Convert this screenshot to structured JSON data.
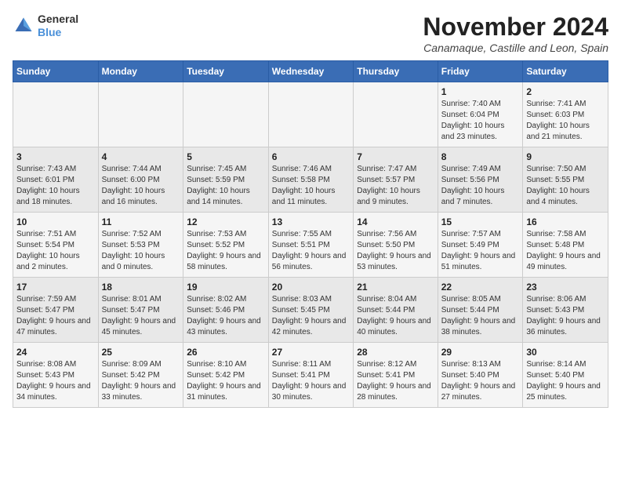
{
  "logo": {
    "general": "General",
    "blue": "Blue"
  },
  "header": {
    "month": "November 2024",
    "location": "Canamaque, Castille and Leon, Spain"
  },
  "weekdays": [
    "Sunday",
    "Monday",
    "Tuesday",
    "Wednesday",
    "Thursday",
    "Friday",
    "Saturday"
  ],
  "weeks": [
    [
      {
        "day": "",
        "info": ""
      },
      {
        "day": "",
        "info": ""
      },
      {
        "day": "",
        "info": ""
      },
      {
        "day": "",
        "info": ""
      },
      {
        "day": "",
        "info": ""
      },
      {
        "day": "1",
        "info": "Sunrise: 7:40 AM\nSunset: 6:04 PM\nDaylight: 10 hours and 23 minutes."
      },
      {
        "day": "2",
        "info": "Sunrise: 7:41 AM\nSunset: 6:03 PM\nDaylight: 10 hours and 21 minutes."
      }
    ],
    [
      {
        "day": "3",
        "info": "Sunrise: 7:43 AM\nSunset: 6:01 PM\nDaylight: 10 hours and 18 minutes."
      },
      {
        "day": "4",
        "info": "Sunrise: 7:44 AM\nSunset: 6:00 PM\nDaylight: 10 hours and 16 minutes."
      },
      {
        "day": "5",
        "info": "Sunrise: 7:45 AM\nSunset: 5:59 PM\nDaylight: 10 hours and 14 minutes."
      },
      {
        "day": "6",
        "info": "Sunrise: 7:46 AM\nSunset: 5:58 PM\nDaylight: 10 hours and 11 minutes."
      },
      {
        "day": "7",
        "info": "Sunrise: 7:47 AM\nSunset: 5:57 PM\nDaylight: 10 hours and 9 minutes."
      },
      {
        "day": "8",
        "info": "Sunrise: 7:49 AM\nSunset: 5:56 PM\nDaylight: 10 hours and 7 minutes."
      },
      {
        "day": "9",
        "info": "Sunrise: 7:50 AM\nSunset: 5:55 PM\nDaylight: 10 hours and 4 minutes."
      }
    ],
    [
      {
        "day": "10",
        "info": "Sunrise: 7:51 AM\nSunset: 5:54 PM\nDaylight: 10 hours and 2 minutes."
      },
      {
        "day": "11",
        "info": "Sunrise: 7:52 AM\nSunset: 5:53 PM\nDaylight: 10 hours and 0 minutes."
      },
      {
        "day": "12",
        "info": "Sunrise: 7:53 AM\nSunset: 5:52 PM\nDaylight: 9 hours and 58 minutes."
      },
      {
        "day": "13",
        "info": "Sunrise: 7:55 AM\nSunset: 5:51 PM\nDaylight: 9 hours and 56 minutes."
      },
      {
        "day": "14",
        "info": "Sunrise: 7:56 AM\nSunset: 5:50 PM\nDaylight: 9 hours and 53 minutes."
      },
      {
        "day": "15",
        "info": "Sunrise: 7:57 AM\nSunset: 5:49 PM\nDaylight: 9 hours and 51 minutes."
      },
      {
        "day": "16",
        "info": "Sunrise: 7:58 AM\nSunset: 5:48 PM\nDaylight: 9 hours and 49 minutes."
      }
    ],
    [
      {
        "day": "17",
        "info": "Sunrise: 7:59 AM\nSunset: 5:47 PM\nDaylight: 9 hours and 47 minutes."
      },
      {
        "day": "18",
        "info": "Sunrise: 8:01 AM\nSunset: 5:47 PM\nDaylight: 9 hours and 45 minutes."
      },
      {
        "day": "19",
        "info": "Sunrise: 8:02 AM\nSunset: 5:46 PM\nDaylight: 9 hours and 43 minutes."
      },
      {
        "day": "20",
        "info": "Sunrise: 8:03 AM\nSunset: 5:45 PM\nDaylight: 9 hours and 42 minutes."
      },
      {
        "day": "21",
        "info": "Sunrise: 8:04 AM\nSunset: 5:44 PM\nDaylight: 9 hours and 40 minutes."
      },
      {
        "day": "22",
        "info": "Sunrise: 8:05 AM\nSunset: 5:44 PM\nDaylight: 9 hours and 38 minutes."
      },
      {
        "day": "23",
        "info": "Sunrise: 8:06 AM\nSunset: 5:43 PM\nDaylight: 9 hours and 36 minutes."
      }
    ],
    [
      {
        "day": "24",
        "info": "Sunrise: 8:08 AM\nSunset: 5:43 PM\nDaylight: 9 hours and 34 minutes."
      },
      {
        "day": "25",
        "info": "Sunrise: 8:09 AM\nSunset: 5:42 PM\nDaylight: 9 hours and 33 minutes."
      },
      {
        "day": "26",
        "info": "Sunrise: 8:10 AM\nSunset: 5:42 PM\nDaylight: 9 hours and 31 minutes."
      },
      {
        "day": "27",
        "info": "Sunrise: 8:11 AM\nSunset: 5:41 PM\nDaylight: 9 hours and 30 minutes."
      },
      {
        "day": "28",
        "info": "Sunrise: 8:12 AM\nSunset: 5:41 PM\nDaylight: 9 hours and 28 minutes."
      },
      {
        "day": "29",
        "info": "Sunrise: 8:13 AM\nSunset: 5:40 PM\nDaylight: 9 hours and 27 minutes."
      },
      {
        "day": "30",
        "info": "Sunrise: 8:14 AM\nSunset: 5:40 PM\nDaylight: 9 hours and 25 minutes."
      }
    ]
  ]
}
